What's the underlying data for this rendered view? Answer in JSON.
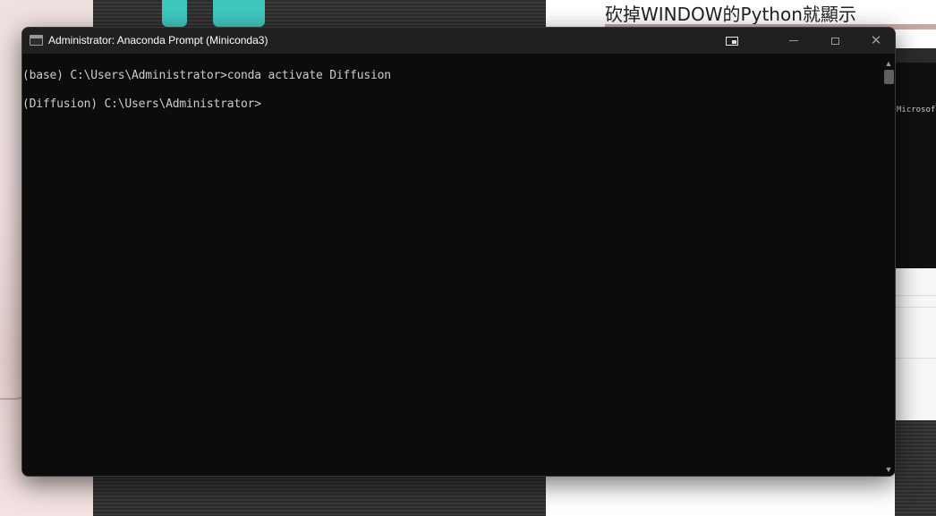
{
  "background": {
    "caption": "砍掉WINDOW的Python就顯示",
    "side_text": "Microsoft"
  },
  "window": {
    "title": "Administrator: Anaconda Prompt (Miniconda3)",
    "icon": "console-app-icon",
    "controls": {
      "pin": "pin-icon",
      "minimize": "minimize-icon",
      "maximize": "maximize-icon",
      "close": "✕"
    }
  },
  "console": {
    "lines": [
      "(base) C:\\Users\\Administrator>conda activate Diffusion",
      "(Diffusion) C:\\Users\\Administrator>"
    ]
  },
  "scrollbar": {
    "up": "▲",
    "down": "▼"
  }
}
